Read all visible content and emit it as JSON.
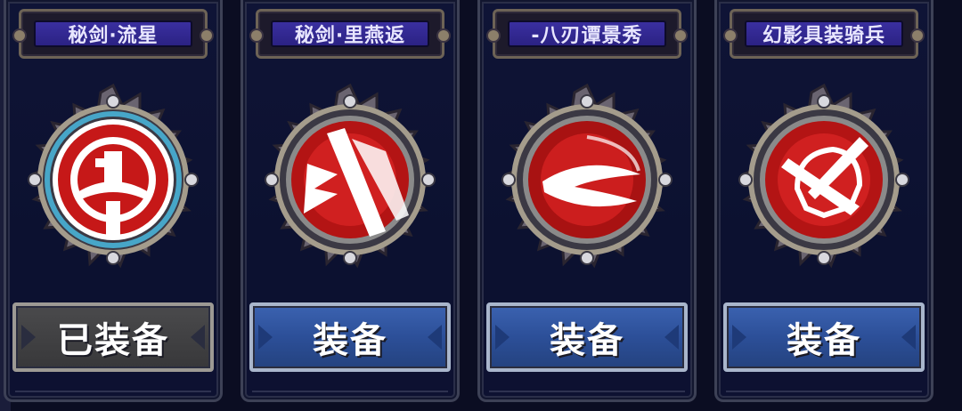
{
  "skills": [
    {
      "title": "秘剑·流星",
      "button_label": "已装备",
      "state": "equipped",
      "icon": "numeral-one-icon",
      "ring_accent": "#47a6c8"
    },
    {
      "title": "秘剑·里燕返",
      "button_label": "装备",
      "state": "equip",
      "icon": "sword-slash-icon",
      "ring_accent": "#8a8a8a"
    },
    {
      "title": "-八刃谭景秀",
      "button_label": "装备",
      "state": "equip",
      "icon": "wind-slash-icon",
      "ring_accent": "#8a8a8a"
    },
    {
      "title": "幻影具装骑兵",
      "button_label": "装备",
      "state": "equip",
      "icon": "horse-helm-icon",
      "ring_accent": "#8a8a8a"
    }
  ],
  "colors": {
    "background": "#0b0d22",
    "title_plate": "#2b2283",
    "equip_button": "#2c4f98",
    "equipped_button": "#38383a",
    "emblem_red": "#c61818"
  }
}
